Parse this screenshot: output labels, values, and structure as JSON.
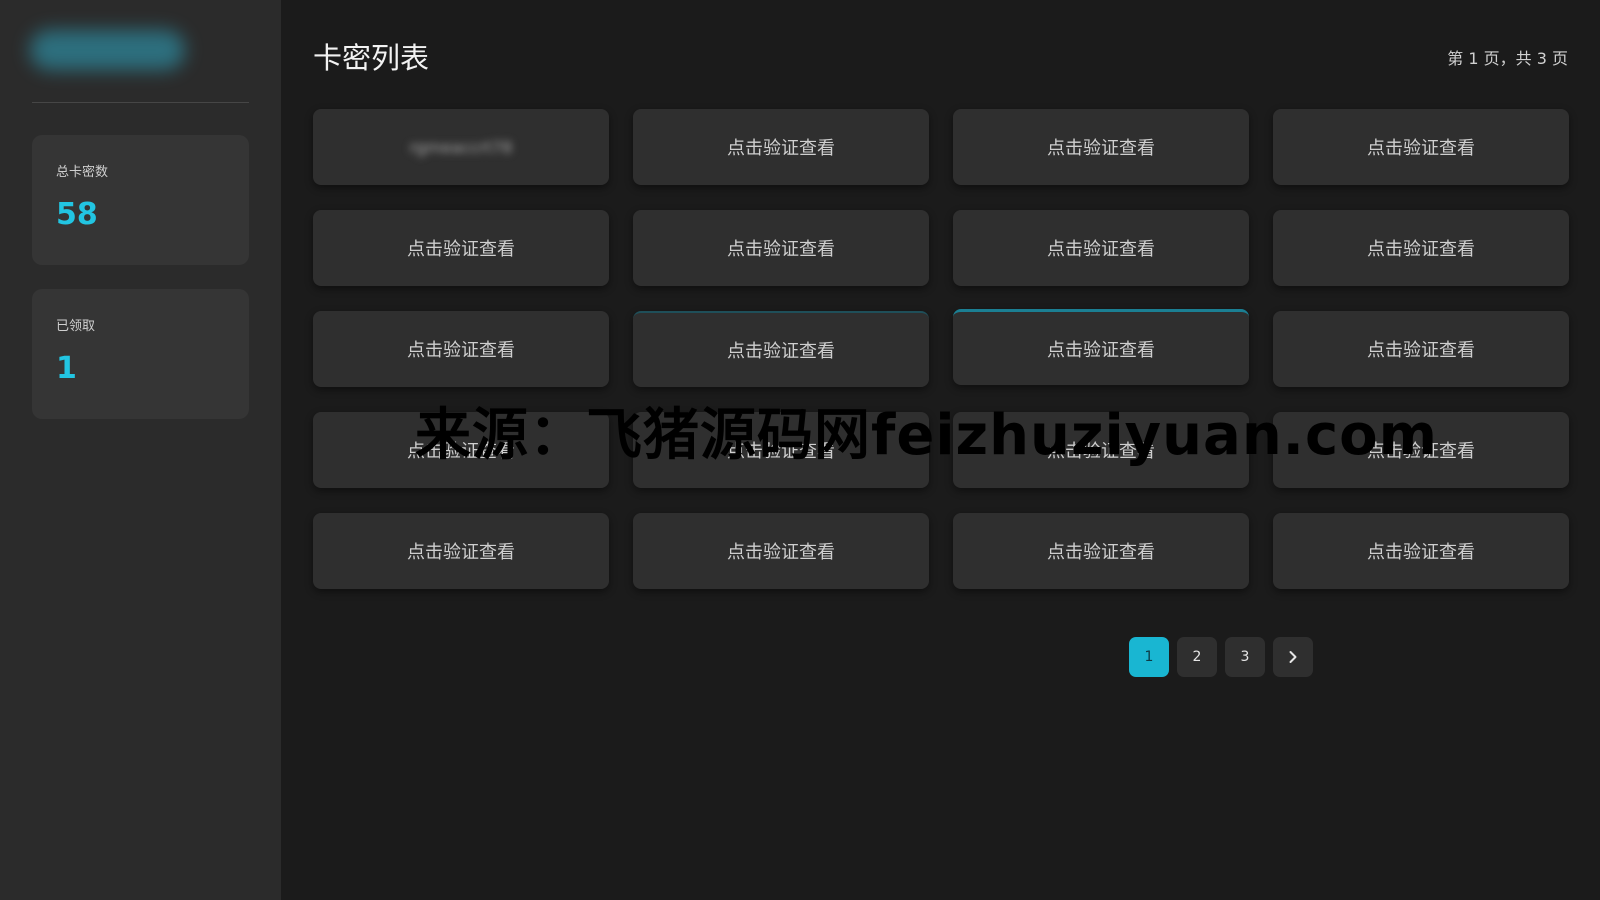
{
  "sidebar": {
    "stats": [
      {
        "label": "总卡密数",
        "value": "58"
      },
      {
        "label": "已领取",
        "value": "1"
      }
    ]
  },
  "main": {
    "title": "卡密列表",
    "page_info": "第 1 页，共 3 页",
    "cards": [
      {
        "label": "rgmeaccrt78",
        "state": "revealed-blurred"
      },
      {
        "label": "点击验证查看"
      },
      {
        "label": "点击验证查看"
      },
      {
        "label": "点击验证查看"
      },
      {
        "label": "点击验证查看"
      },
      {
        "label": "点击验证查看"
      },
      {
        "label": "点击验证查看"
      },
      {
        "label": "点击验证查看"
      },
      {
        "label": "点击验证查看"
      },
      {
        "label": "点击验证查看"
      },
      {
        "label": "点击验证查看"
      },
      {
        "label": "点击验证查看"
      },
      {
        "label": "点击验证查看"
      },
      {
        "label": "点击验证查看"
      },
      {
        "label": "点击验证查看"
      },
      {
        "label": "点击验证查看"
      },
      {
        "label": "点击验证查看"
      },
      {
        "label": "点击验证查看"
      },
      {
        "label": "点击验证查看"
      },
      {
        "label": "点击验证查看"
      }
    ]
  },
  "pagination": {
    "pages": [
      "1",
      "2",
      "3"
    ],
    "current": "1",
    "next_icon": "chevron-right-icon"
  },
  "watermark": "来源：飞猪源码网feizhuziyuan.com",
  "colors": {
    "accent": "#19b6d2",
    "stat_value": "#22c5e2",
    "background": "#1b1b1b",
    "sidebar": "#2b2b2b",
    "card": "#2f2f2f"
  }
}
